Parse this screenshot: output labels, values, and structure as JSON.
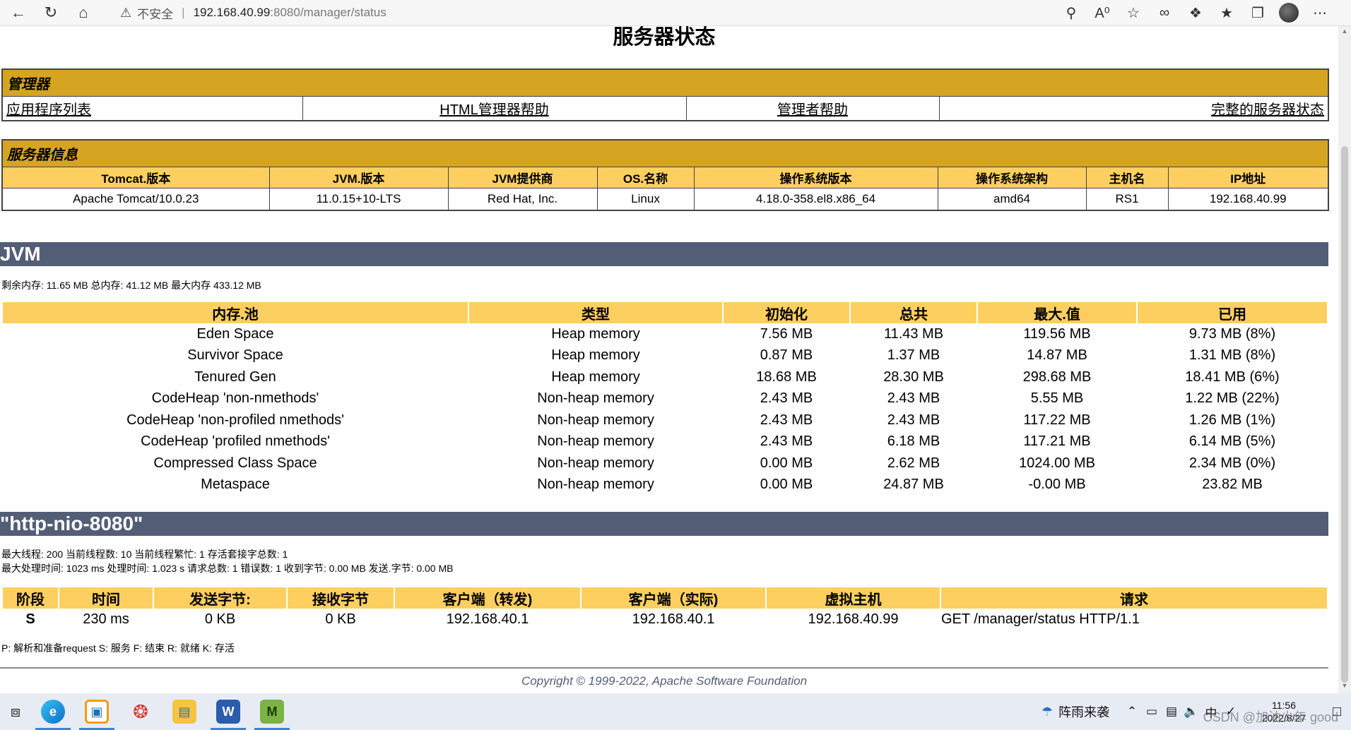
{
  "browser": {
    "security_label": "不安全",
    "url_host": "192.168.40.99",
    "url_rest": ":8080/manager/status"
  },
  "page": {
    "title": "服务器状态"
  },
  "manager": {
    "heading": "管理器",
    "links": [
      "应用程序列表",
      "HTML管理器帮助",
      "管理者帮助",
      "完整的服务器状态"
    ]
  },
  "server_info": {
    "heading": "服务器信息",
    "headers": [
      "Tomcat.版本",
      "JVM.版本",
      "JVM提供商",
      "OS.名称",
      "操作系统版本",
      "操作系统架构",
      "主机名",
      "IP地址"
    ],
    "values": [
      "Apache Tomcat/10.0.23",
      "11.0.15+10-LTS",
      "Red Hat, Inc.",
      "Linux",
      "4.18.0-358.el8.x86_64",
      "amd64",
      "RS1",
      "192.168.40.99"
    ]
  },
  "jvm": {
    "heading": "JVM",
    "summary": "剩余内存:  11.65 MB 总内存:  41.12 MB 最大内存 433.12 MB",
    "headers": [
      "内存.池",
      "类型",
      "初始化",
      "总共",
      "最大.值",
      "已用"
    ],
    "rows": [
      [
        "Eden Space",
        "Heap memory",
        "7.56 MB",
        "11.43 MB",
        "119.56 MB",
        "9.73 MB (8%)"
      ],
      [
        "Survivor Space",
        "Heap memory",
        "0.87 MB",
        "1.37 MB",
        "14.87 MB",
        "1.31 MB (8%)"
      ],
      [
        "Tenured Gen",
        "Heap memory",
        "18.68 MB",
        "28.30 MB",
        "298.68 MB",
        "18.41 MB (6%)"
      ],
      [
        "CodeHeap 'non-nmethods'",
        "Non-heap memory",
        "2.43 MB",
        "2.43 MB",
        "5.55 MB",
        "1.22 MB (22%)"
      ],
      [
        "CodeHeap 'non-profiled nmethods'",
        "Non-heap memory",
        "2.43 MB",
        "2.43 MB",
        "117.22 MB",
        "1.26 MB (1%)"
      ],
      [
        "CodeHeap 'profiled nmethods'",
        "Non-heap memory",
        "2.43 MB",
        "6.18 MB",
        "117.21 MB",
        "6.14 MB (5%)"
      ],
      [
        "Compressed Class Space",
        "Non-heap memory",
        "0.00 MB",
        "2.62 MB",
        "1024.00 MB",
        "2.34 MB (0%)"
      ],
      [
        "Metaspace",
        "Non-heap memory",
        "0.00 MB",
        "24.87 MB",
        "-0.00 MB",
        "23.82 MB"
      ]
    ]
  },
  "connector": {
    "heading": "\"http-nio-8080\"",
    "line1": "最大线程:  200 当前线程数:  10 当前线程繁忙:  1 存活套接字总数:  1",
    "line2": "最大处理时间:  1023 ms 处理时间:  1.023 s 请求总数:  1 错误数:  1 收到字节:  0.00 MB 发送.字节: 0.00 MB",
    "headers": [
      "阶段",
      "时间",
      "发送字节:",
      "接收字节",
      "客户端（转发)",
      "客户端（实际)",
      "虚拟主机",
      "请求"
    ],
    "row": [
      "S",
      "230 ms",
      "0 KB",
      "0 KB",
      "192.168.40.1",
      "192.168.40.1",
      "192.168.40.99",
      "GET /manager/status HTTP/1.1"
    ],
    "legend": "P:  解析和准备request S:  服务 F:  结束 R:  就绪 K:  存活"
  },
  "footer": {
    "copyright": "Copyright © 1999-2022, Apache Software Foundation"
  },
  "taskbar": {
    "weather": "阵雨来袭",
    "time": "11:56",
    "date": "2022/8/27",
    "watermark": "CSDN @加油少年 good"
  }
}
